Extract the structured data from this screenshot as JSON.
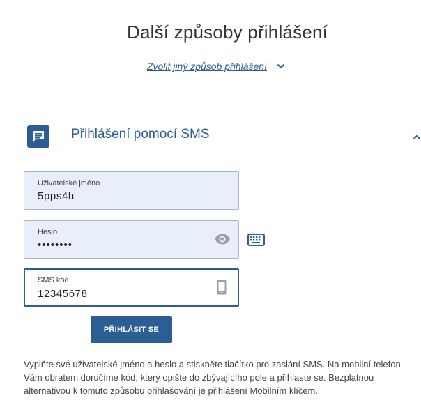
{
  "page": {
    "title": "Další způsoby přihlášení",
    "other_method_label": "Zvolit jiný způsob přihlášení"
  },
  "section": {
    "title": "Přihlášení pomocí SMS"
  },
  "form": {
    "username": {
      "label": "Uživatelské jméno",
      "value": "5pps4h"
    },
    "password": {
      "label": "Heslo",
      "value": "••••••••"
    },
    "sms": {
      "label": "SMS kód",
      "value": "12345678"
    },
    "submit_label": "PŘIHLÁSIT SE"
  },
  "help_text": "Vyplňte své uživatelské jméno a heslo a stiskněte tlačítko pro zaslání SMS. Na mobilní telefon Vám obratem doručíme kód, který opište do zbývajícího pole a přihlaste se. Bezplatnou alternativou k tomuto způsobu přihlašování je přihlášení Mobilním klíčem.",
  "colors": {
    "accent": "#2d5e93",
    "field_background": "#e8effa",
    "text": "#333333"
  },
  "icons": {
    "dropdown": "chevron-down-icon",
    "section": "sms-message-icon",
    "collapse": "chevron-up-icon",
    "password_toggle": "eye-icon",
    "virtual_keyboard": "keyboard-icon",
    "sms_field": "smartphone-icon"
  }
}
